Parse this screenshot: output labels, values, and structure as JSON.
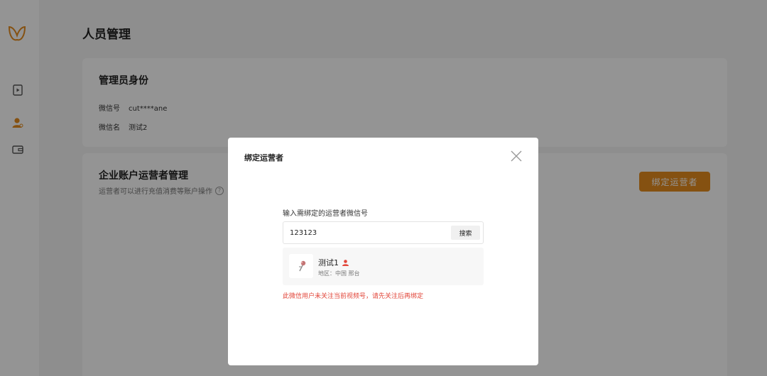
{
  "page": {
    "title": "人员管理"
  },
  "admin_card": {
    "title": "管理员身份",
    "wechat_id_label": "微信号",
    "wechat_id_value": "cut****ane",
    "wechat_name_label": "微信名",
    "wechat_name_value": "测试2"
  },
  "ops_card": {
    "title": "企业账户运营者管理",
    "subtitle": "运营者可以进行充值消费等账户操作",
    "help_glyph": "?",
    "bind_button": "绑定运营者"
  },
  "modal": {
    "title": "绑定运营者",
    "field_label": "输入需绑定的运营者微信号",
    "input_value": "123123",
    "search_button": "搜索",
    "result": {
      "name": "测试1",
      "region": "地区：中国 邢台"
    },
    "error": "此微信用户未关注当前视频号，请先关注后再绑定"
  },
  "colors": {
    "accent": "#e58c1e",
    "error": "#e2463a",
    "person_icon": "#e2463a"
  }
}
